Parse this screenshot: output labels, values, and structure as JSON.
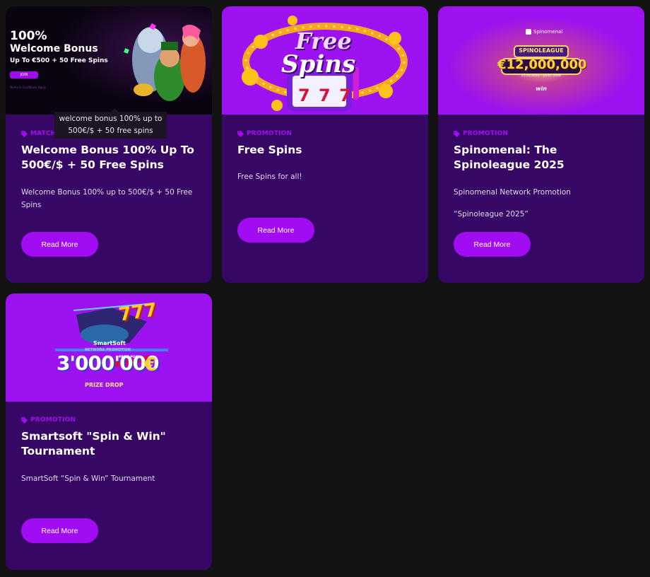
{
  "cards": [
    {
      "tag": "MATCH",
      "title": "Welcome Bonus 100% Up To 500€/$ + 50 Free Spins",
      "desc": "Welcome Bonus 100% up to 500€/$ + 50 Free Spins",
      "button": "Read More",
      "banner": {
        "line1": "100%",
        "line2": "Welcome Bonus",
        "line3": "Up To €500 + 50 Free Spins",
        "cta": "JOIN",
        "fine": "Terms & Conditions Apply"
      }
    },
    {
      "tag": "PROMOTION",
      "title": "Free Spins",
      "desc": "Free Spins for all!",
      "button": "Read More",
      "banner": {
        "word1": "Free",
        "word2": "Spins",
        "reel": "7 7 7"
      }
    },
    {
      "tag": "PROMOTION",
      "title": "Spinomenal: The Spinoleague 2025",
      "desc": "Spinomenal Network Promotion",
      "desc2": "“Spinoleague 2025”",
      "button": "Read More",
      "banner": {
        "brand": "Spinomenal",
        "league": "SPINOLEAGUE",
        "amount": "€12,000,000",
        "dates": "21.01.2025 - 19.01.2026",
        "sub": "win"
      }
    },
    {
      "tag": "PROMOTION",
      "title": "Smartsoft \"Spin & Win\" Tournament",
      "desc": "SmartSoft “Spin & Win” Tournament",
      "button": "Read More",
      "banner": {
        "sevens": "777",
        "brand": "SmartSoft",
        "network": "NETWORK PROMOTION",
        "amount": "3'000'000",
        "currency": "€",
        "pool": "PRIZE POOL",
        "drop": "PRIZE DROP"
      }
    }
  ],
  "tooltip": "welcome bonus 100% up to 500€/$ + 50 free spins",
  "colors": {
    "card_bg": "#370765",
    "accent": "#a20cf3",
    "page_bg": "#131313"
  }
}
